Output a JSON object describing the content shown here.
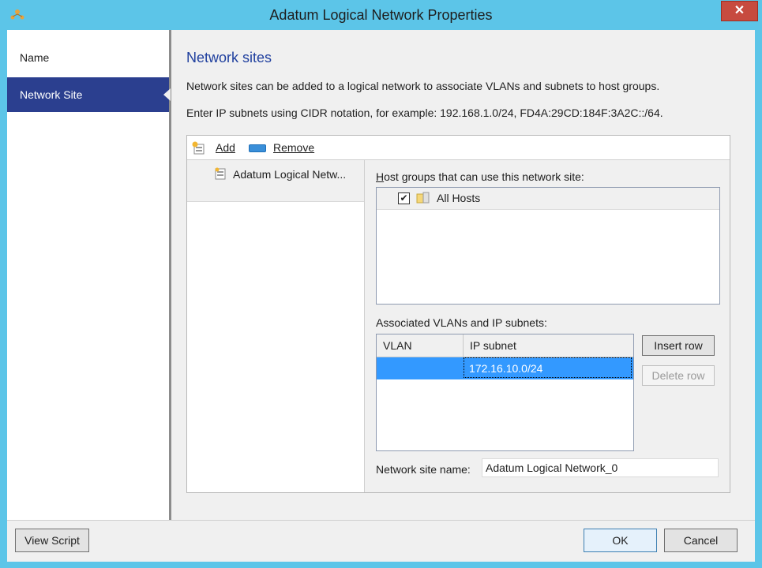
{
  "window": {
    "title": "Adatum Logical Network Properties",
    "close_symbol": "✕"
  },
  "nav": {
    "items": [
      {
        "label": "Name",
        "active": false
      },
      {
        "label": "Network Site",
        "active": true
      }
    ]
  },
  "main": {
    "section_title": "Network sites",
    "description_1": "Network sites can be added to a logical network to associate VLANs and subnets to host groups.",
    "description_2": "Enter IP subnets using CIDR notation, for example: 192.168.1.0/24, FD4A:29CD:184F:3A2C::/64.",
    "toolbar": {
      "add_label": "Add",
      "remove_label": "Remove",
      "add_icon": "add-site-icon",
      "remove_icon": "remove-icon"
    },
    "sites": [
      {
        "label": "Adatum Logical Netw..."
      }
    ],
    "host_groups": {
      "label": "Host groups that can use this network site:",
      "items": [
        {
          "label": "All Hosts",
          "checked": true,
          "check_symbol": "✔"
        }
      ]
    },
    "vlans": {
      "label": "Associated VLANs and IP subnets:",
      "columns": [
        "VLAN",
        "IP subnet"
      ],
      "rows": [
        {
          "vlan": "",
          "ip_subnet": "172.16.10.0/24",
          "selected": true
        }
      ],
      "insert_row_label": "Insert row",
      "delete_row_label": "Delete row"
    },
    "site_name": {
      "label": "Network site name:",
      "value": "Adatum Logical Network_0"
    }
  },
  "footer": {
    "view_script_label": "View Script",
    "ok_label": "OK",
    "cancel_label": "Cancel"
  },
  "colors": {
    "frame": "#5cc5e8",
    "nav_active": "#2b3f8f",
    "section_title": "#1f3f9e",
    "selection": "#3399ff",
    "close_button": "#c74b3f"
  }
}
